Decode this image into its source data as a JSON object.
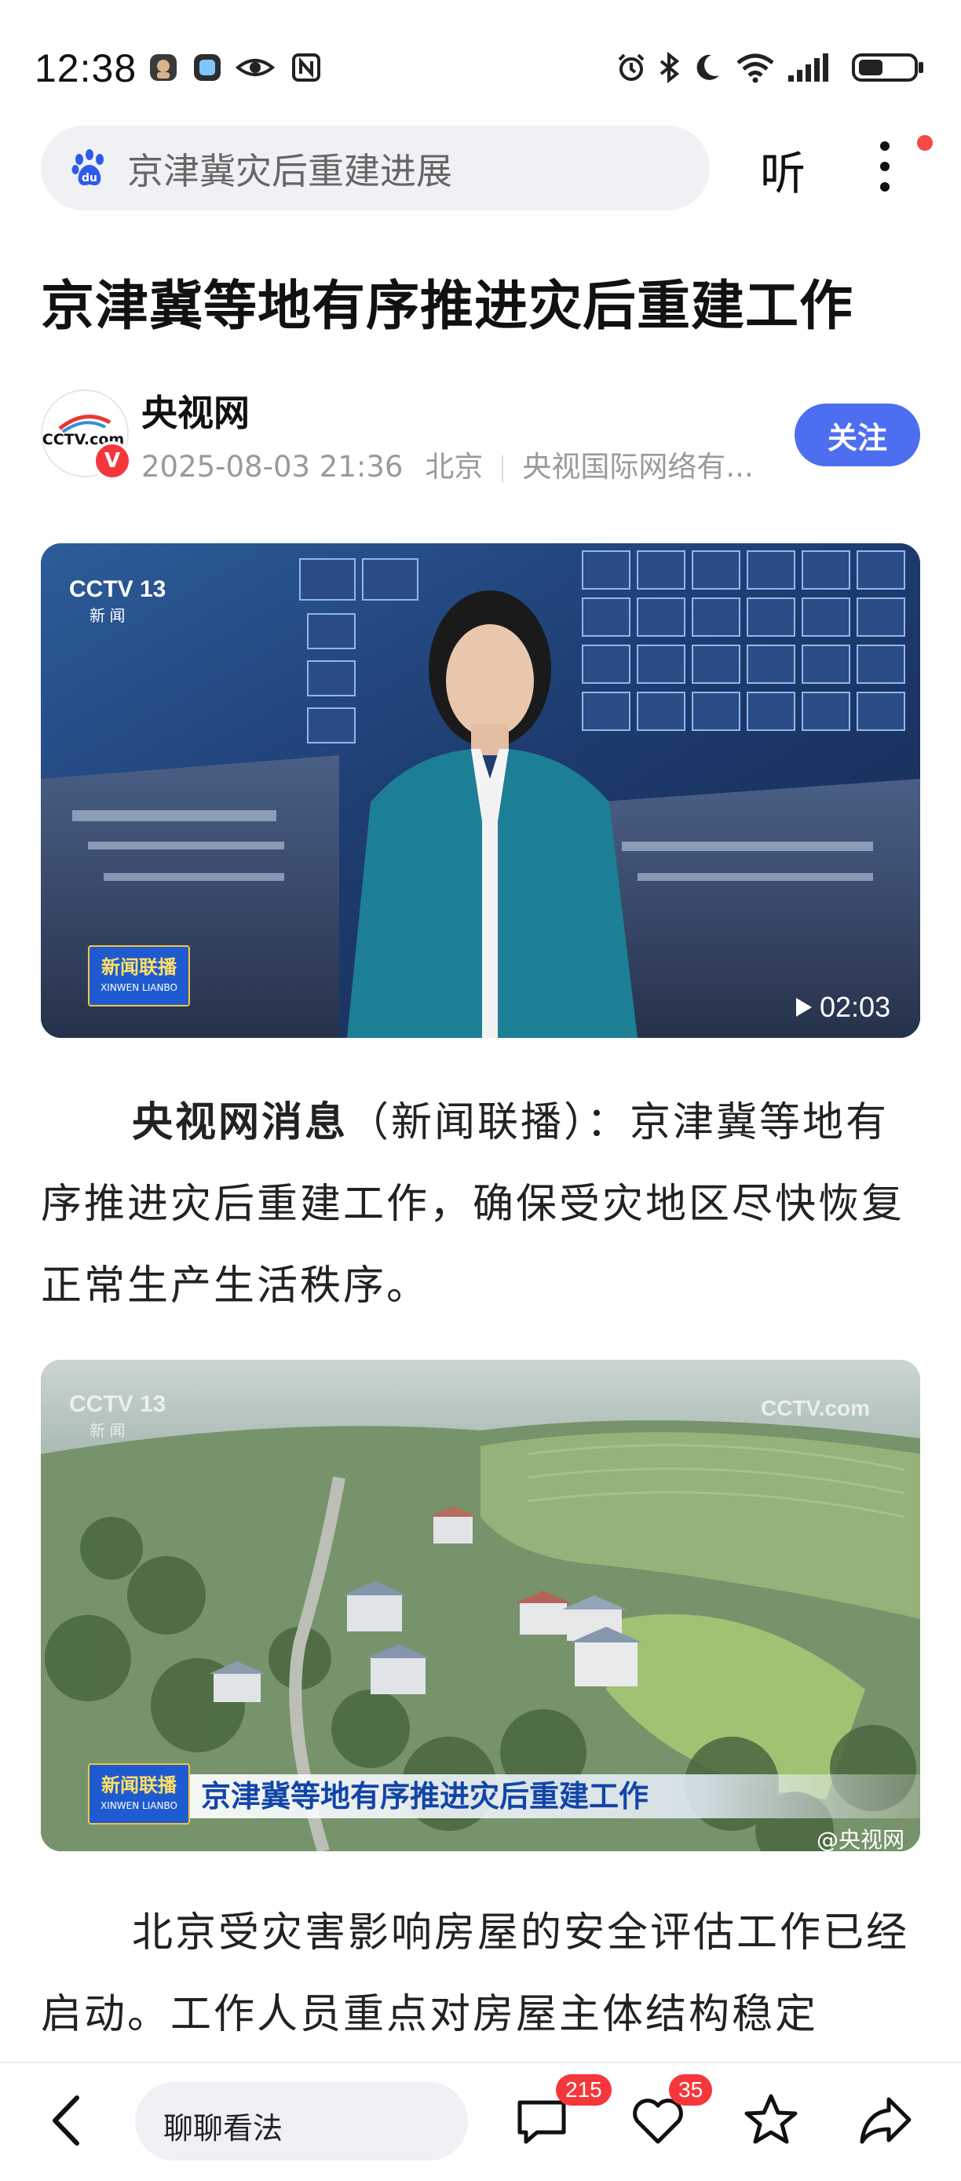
{
  "status_bar": {
    "time": "12:38",
    "left_icons": [
      "app-icon-1",
      "app-icon-2",
      "eye-icon",
      "nfc-icon"
    ],
    "right_icons": [
      "alarm-icon",
      "bluetooth-icon",
      "moon-icon",
      "wifi-icon",
      "signal-icon",
      "battery-icon"
    ]
  },
  "search": {
    "query": "京津冀灾后重建进展",
    "listen_label": "听"
  },
  "article": {
    "title": "京津冀等地有序推进灾后重建工作",
    "source_name": "央视网",
    "verified_mark": "V",
    "datetime": "2025-08-03 21:36",
    "location": "北京",
    "publisher": "央视国际网络有...",
    "follow_label": "关注",
    "video": {
      "channel_logo": "CCTV 13",
      "channel_sub": "新 闻",
      "program_logo": "新闻联播",
      "program_sub": "XINWEN LIANBO",
      "duration": "02:03"
    },
    "para1_lead": "央视网消息",
    "para1_rest": "（新闻联播）：京津冀等地有序推进灾后重建工作，确保受灾地区尽快恢复正常生产生活秩序。",
    "photo": {
      "channel_logo": "CCTV 13",
      "channel_sub": "新 闻",
      "watermark": "CCTV.com",
      "program_logo": "新闻联播",
      "program_sub": "XINWEN LIANBO",
      "caption": "京津冀等地有序推进灾后重建工作",
      "credit": "@央视网"
    },
    "para2": "北京受灾害影响房屋的安全评估工作已经启动。工作人员重点对房屋主体结构稳定"
  },
  "bottom_bar": {
    "comment_placeholder": "聊聊看法",
    "comment_count": "215",
    "like_count": "35"
  },
  "colors": {
    "accent_blue": "#4e6ef2",
    "badge_red": "#f5373b"
  }
}
